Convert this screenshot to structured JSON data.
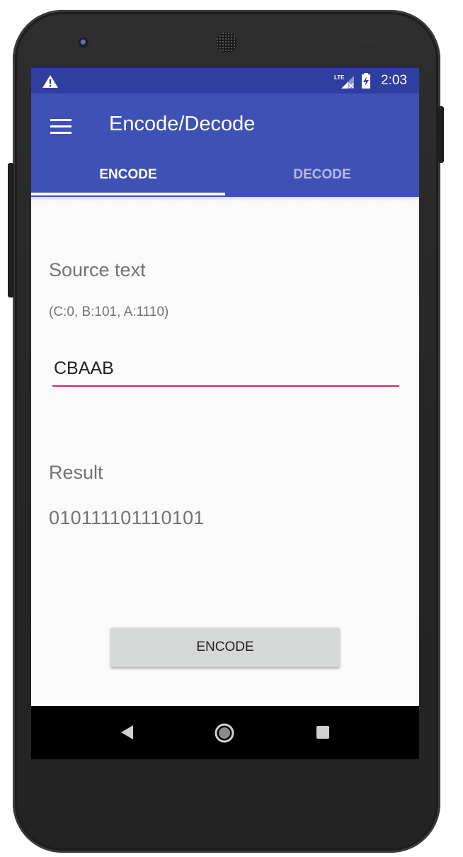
{
  "status_bar": {
    "time": "2:03",
    "network_label": "LTE",
    "icons": [
      "warning-icon",
      "lte-signal-icon",
      "battery-charging-icon"
    ]
  },
  "app_bar": {
    "title": "Encode/Decode",
    "menu_icon": "hamburger-menu-icon"
  },
  "tabs": [
    {
      "label": "ENCODE",
      "selected": true
    },
    {
      "label": "DECODE",
      "selected": false
    }
  ],
  "encode_form": {
    "source_label": "Source text",
    "code_hint": "(C:0, B:101, A:1110)",
    "source_value": "CBAAB",
    "result_label": "Result",
    "result_value": "010111101110101",
    "button_label": "ENCODE"
  },
  "nav_bar": {
    "icons": [
      "back-icon",
      "home-icon",
      "recents-icon"
    ]
  },
  "colors": {
    "status_bar": "#303f9f",
    "app_bar": "#3f51b5",
    "accent": "#e91e63",
    "background": "#fafafa",
    "button": "#d6d7d7"
  }
}
